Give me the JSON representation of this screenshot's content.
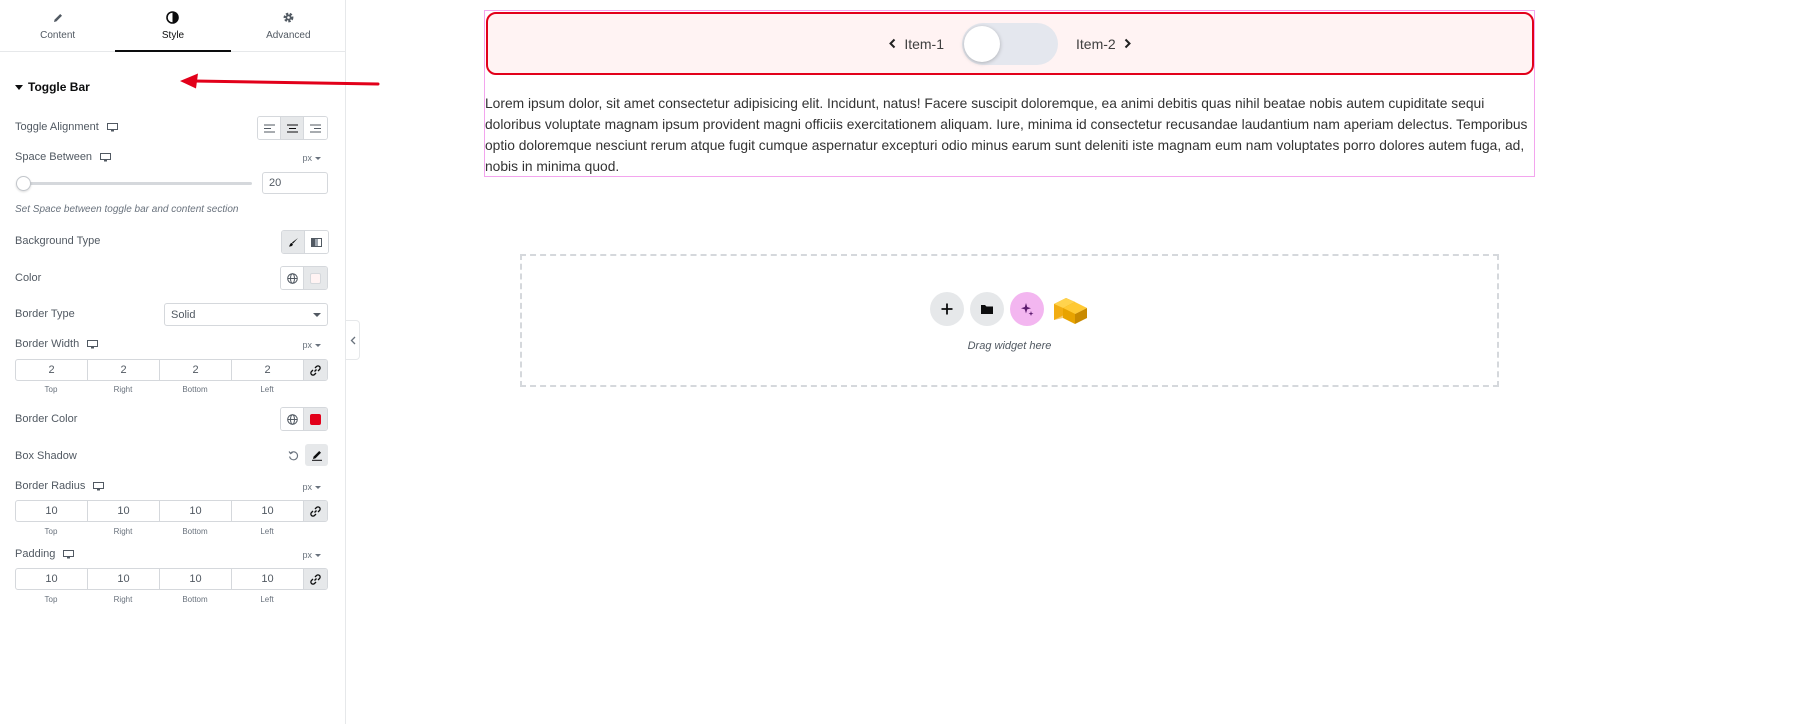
{
  "tabs": [
    {
      "label": "Content",
      "icon": "pencil-icon"
    },
    {
      "label": "Style",
      "icon": "contrast-icon"
    },
    {
      "label": "Advanced",
      "icon": "gear-icon"
    }
  ],
  "section": {
    "title": "Toggle Bar"
  },
  "controls": {
    "toggle_alignment": {
      "label": "Toggle Alignment",
      "selected": "center"
    },
    "space_between": {
      "label": "Space Between",
      "unit": "px",
      "value": "20",
      "slider_fraction": 0.0,
      "hint": "Set Space between toggle bar and content section"
    },
    "background_type": {
      "label": "Background Type"
    },
    "color": {
      "label": "Color",
      "value": "#fff3f3"
    },
    "border_type": {
      "label": "Border Type",
      "value": "Solid"
    },
    "border_width": {
      "label": "Border Width",
      "unit": "px",
      "values": [
        "2",
        "2",
        "2",
        "2"
      ]
    },
    "border_color": {
      "label": "Border Color",
      "value": "#e2001a"
    },
    "box_shadow": {
      "label": "Box Shadow"
    },
    "border_radius": {
      "label": "Border Radius",
      "unit": "px",
      "values": [
        "10",
        "10",
        "10",
        "10"
      ]
    },
    "padding": {
      "label": "Padding",
      "unit": "px",
      "values": [
        "10",
        "10",
        "10",
        "10"
      ]
    },
    "dim_labels": [
      "Top",
      "Right",
      "Bottom",
      "Left"
    ]
  },
  "canvas": {
    "toggle": {
      "item1": "Item-1",
      "item2": "Item-2"
    },
    "content_text": "Lorem ipsum dolor, sit amet consectetur adipisicing elit. Incidunt, natus! Facere suscipit doloremque, ea animi debitis quas nihil beatae nobis autem cupiditate sequi doloribus voluptate magnam ipsum provident magni officiis exercitationem aliquam. Iure, minima id consectetur recusandae laudantium nam aperiam delectus. Temporibus optio doloremque nesciunt rerum atque fugit cumque aspernatur excepturi odio minus earum sunt deleniti iste magnam eum nam voluptates porro dolores autem fuga, ad, nobis in minima quod.",
    "dropzone": {
      "text": "Drag widget here"
    }
  },
  "colors": {
    "accent_red": "#e2001a",
    "ai_pink": "#f3b6f0"
  }
}
